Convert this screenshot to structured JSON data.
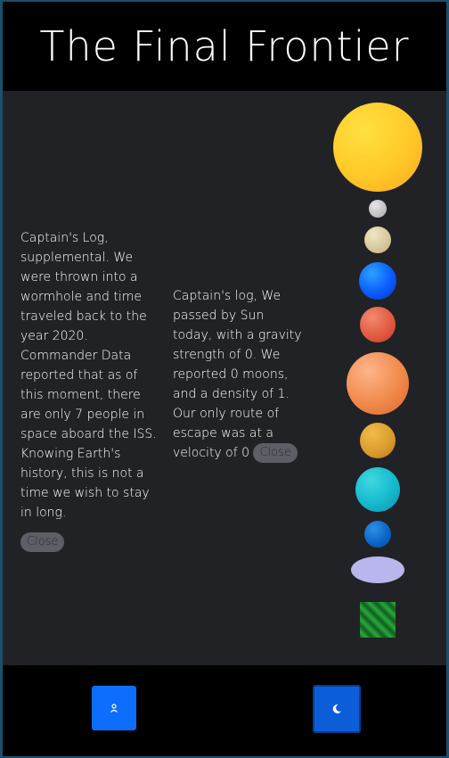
{
  "header": {
    "title": "The Final Frontier"
  },
  "logs": [
    {
      "text": "Captain's Log, supplemental. We were thrown into a wormhole and time traveled back to the year 2020. Commander Data reported that as of this moment, there are only 7 people in space aboard the ISS. Knowing Earth's history, this is not a time we wish to stay in long.",
      "close_label": "Close"
    },
    {
      "text": "Captain's log, We passed by Sun today, with a gravity strength of 0. We reported 0 moons, and a density of 1. Our only route of escape was at a velocity of 0",
      "close_label": "Close"
    }
  ],
  "planets": [
    {
      "name": "sun",
      "color": "#ffc928"
    },
    {
      "name": "mercury",
      "color": "#bdbdbd"
    },
    {
      "name": "venus",
      "color": "#d8c9a0"
    },
    {
      "name": "earth",
      "color": "#0a5cff"
    },
    {
      "name": "mars",
      "color": "#e0573e"
    },
    {
      "name": "jupiter",
      "color": "#f08a4b"
    },
    {
      "name": "saturn",
      "color": "#d99a2b"
    },
    {
      "name": "uranus",
      "color": "#15b9cc"
    },
    {
      "name": "neptune",
      "color": "#0b62c4"
    },
    {
      "name": "pluto",
      "color": "#b9b6ee"
    },
    {
      "name": "asteroid",
      "color": "#1f8a2e"
    }
  ],
  "footer": {
    "astronaut_icon": "astronaut-icon",
    "moon_icon": "moon-icon"
  }
}
